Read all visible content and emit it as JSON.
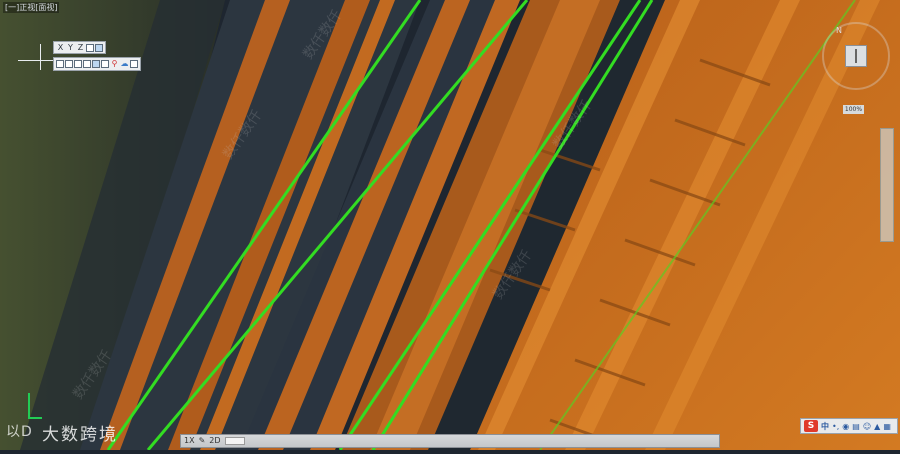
{
  "window": {
    "title": "[一]正视[面视]"
  },
  "view_toolbar": {
    "axis_buttons": [
      "X",
      "Y",
      "Z"
    ],
    "icons": [
      "reset-view-icon",
      "color-palette-icon"
    ]
  },
  "cube_toolbar": {
    "icons": [
      "view-front-icon",
      "view-back-icon",
      "view-left-icon",
      "view-right-icon",
      "view-top-icon",
      "view-iso-icon",
      "pin-icon",
      "cloud-icon",
      "screen-icon"
    ]
  },
  "navigator": {
    "north_label": "N",
    "zoom_label": "100%"
  },
  "status_bar": {
    "fields": [
      "1X",
      "2D"
    ]
  },
  "corner_toolbar": {
    "logo": "S",
    "text": "中",
    "icons": [
      "punctuation-icon",
      "mic-icon",
      "keyboard-icon",
      "user-icon",
      "shirt-icon",
      "grid-icon"
    ]
  },
  "watermark": {
    "logo_text": "以D",
    "text": "大数跨境",
    "tile_text": "数仟数仟"
  },
  "colors": {
    "background": "#1e2630",
    "point_cloud": "#d2691e",
    "rail_line": "#33dd22",
    "ground_strip": "#3a4a28"
  }
}
